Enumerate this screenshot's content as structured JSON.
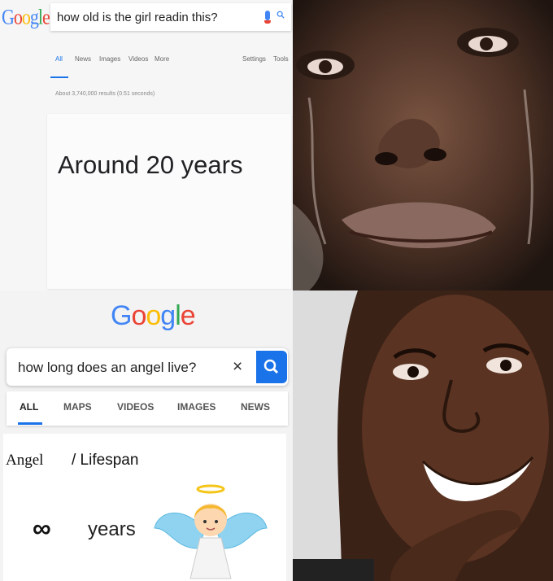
{
  "top": {
    "logo_letters": [
      "G",
      "o",
      "o",
      "g",
      "l",
      "e"
    ],
    "query": "how old is the girl readin this?",
    "tabs": [
      "All",
      "News",
      "Images",
      "Videos",
      "More"
    ],
    "tools": [
      "Settings",
      "Tools"
    ],
    "results_stats": "About 3,740,000 results (0.51 seconds)",
    "answer": "Around 20 years"
  },
  "bottom": {
    "logo_letters": [
      "G",
      "o",
      "o",
      "g",
      "l",
      "e"
    ],
    "query": "how long does an angel live?",
    "clear": "×",
    "tabs": [
      "ALL",
      "MAPS",
      "VIDEOS",
      "IMAGES",
      "NEWS"
    ],
    "label_a": "Angel",
    "label_b": "/ Lifespan",
    "infinity": "∞",
    "years": "years"
  },
  "colors": {
    "google_blue": "#4285f4",
    "google_red": "#ea4335",
    "google_yellow": "#fbbc05",
    "google_green": "#34a853",
    "search_button": "#1a73e8"
  },
  "icons": [
    "microphone-icon",
    "search-icon",
    "clear-icon",
    "angel-emoji-icon"
  ]
}
